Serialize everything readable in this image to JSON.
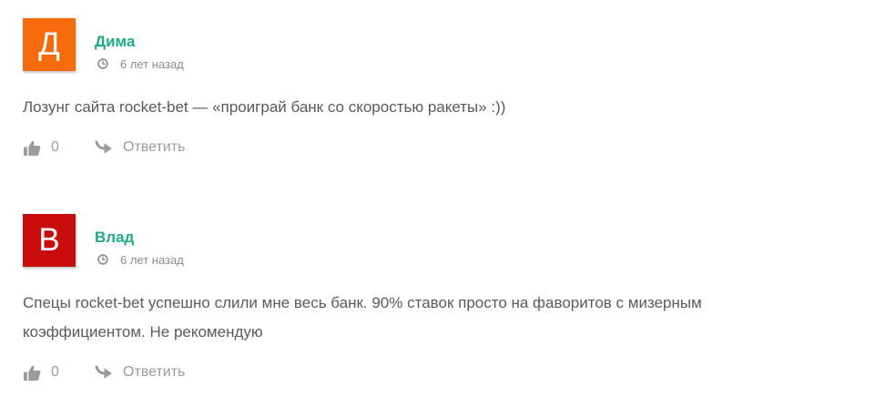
{
  "colors": {
    "author_name": "#1faa85",
    "comment_text": "#5a5a5a",
    "meta_text": "#8c8c8c",
    "action_text": "#9b9b9b"
  },
  "comments": [
    {
      "avatar": {
        "letter": "Д",
        "color": "#f86b0b"
      },
      "author": "Дима",
      "time_icon": "clock-icon",
      "time": "6 лет назад",
      "text": "Лозунг сайта rocket-bet — «проиграй банк со скоростью ракеты» :))",
      "like_icon": "thumbs-up-icon",
      "likes": 0,
      "reply_icon": "reply-arrow-icon",
      "reply_label": "Ответить"
    },
    {
      "avatar": {
        "letter": "В",
        "color": "#c90c0c"
      },
      "author": "Влад",
      "time_icon": "clock-icon",
      "time": "6 лет назад",
      "text": "Спецы rocket-bet успешно слили мне весь банк. 90% ставок просто на фаворитов с мизерным коэффициентом. Не рекомендую",
      "like_icon": "thumbs-up-icon",
      "likes": 0,
      "reply_icon": "reply-arrow-icon",
      "reply_label": "Ответить"
    }
  ]
}
